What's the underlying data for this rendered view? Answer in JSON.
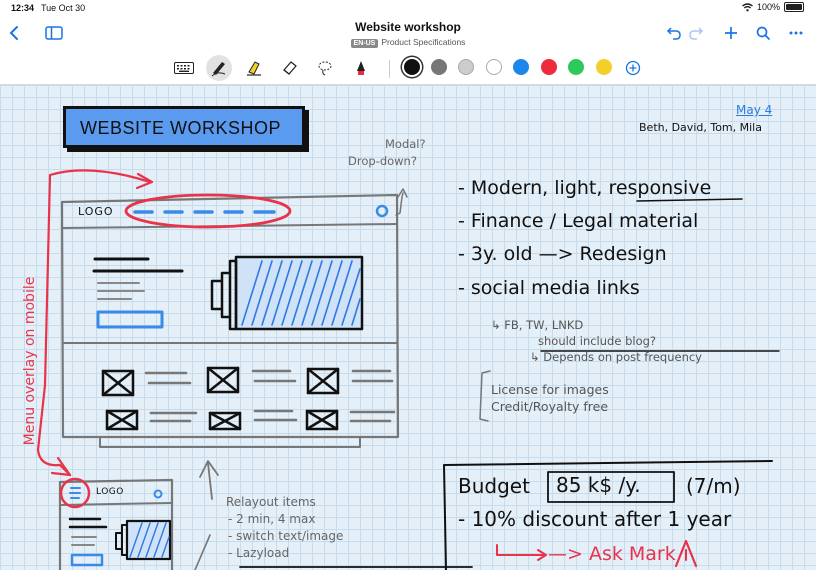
{
  "status": {
    "time": "12:34",
    "date": "Tue Oct 30",
    "battery": "100%"
  },
  "nav": {
    "title": "Website workshop",
    "badge": "EN-US",
    "subtitle": "Product Specifications"
  },
  "icons": {
    "back": "chevron-left-icon",
    "sidebar": "sidebar-icon",
    "undo": "undo-icon",
    "redo": "redo-icon",
    "add": "plus-icon",
    "search": "search-icon",
    "more": "more-icon",
    "tools": [
      "keyboard-icon",
      "pen-icon",
      "highlighter-icon",
      "eraser-icon",
      "lasso-icon",
      "shape-icon"
    ]
  },
  "colors": {
    "accent": "#1a73e8",
    "palette": [
      "#111111",
      "#777777",
      "#cccccc",
      "#ffffff",
      "#1e86ea",
      "#ee2a3c",
      "#2ec95b",
      "#f2cf2a"
    ]
  },
  "note": {
    "banner": "WEBSITE WORKSHOP",
    "date": "May 4",
    "attendees": "Beth, David, Tom, Mila",
    "modal": "Modal?",
    "dropdown": "Drop-down?",
    "logo": "LOGO",
    "menu_note": "Menu overlay on mobile",
    "bullets": [
      "- Modern, light, responsive",
      "- Finance / Legal material",
      "- 3y. old —> Redesign",
      "- social media links"
    ],
    "sub1": "↳ FB, TW, LNKD",
    "sub2": "should include blog?",
    "sub3": "↳ Depends on post frequency",
    "license1": "License for images",
    "license2": "Credit/Royalty free",
    "relayout": [
      "Relayout items",
      "- 2 min, 4 max",
      "- switch text/image",
      "- Lazyload"
    ],
    "budget_label": "Budget",
    "budget_value": "85 k$ /y.",
    "budget_month": "(7/m)",
    "discount": "- 10% discount after 1 year",
    "ask": "—> Ask Mark"
  }
}
